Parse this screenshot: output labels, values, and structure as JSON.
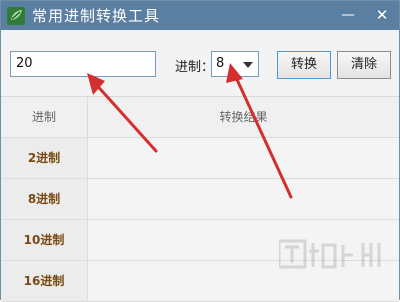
{
  "window": {
    "title": "常用进制转换工具",
    "minimize_symbol": "—",
    "close_symbol": "✕"
  },
  "toolbar": {
    "number_value": "20",
    "base_label": "进制：",
    "base_selected": "8",
    "convert_label": "转换",
    "clear_label": "清除"
  },
  "table": {
    "headers": [
      "进制",
      "转换结果"
    ],
    "rows": [
      {
        "label": "2进制",
        "value": ""
      },
      {
        "label": "8进制",
        "value": ""
      },
      {
        "label": "10进制",
        "value": ""
      },
      {
        "label": "16进制",
        "value": ""
      }
    ]
  },
  "colors": {
    "titlebar": "#5b7fa0",
    "row_label_text": "#7a4a14",
    "annotation_arrow": "#d32f2f"
  },
  "icons": [
    "app-leaf-icon",
    "minimize-icon",
    "close-icon",
    "dropdown-arrow-icon"
  ]
}
